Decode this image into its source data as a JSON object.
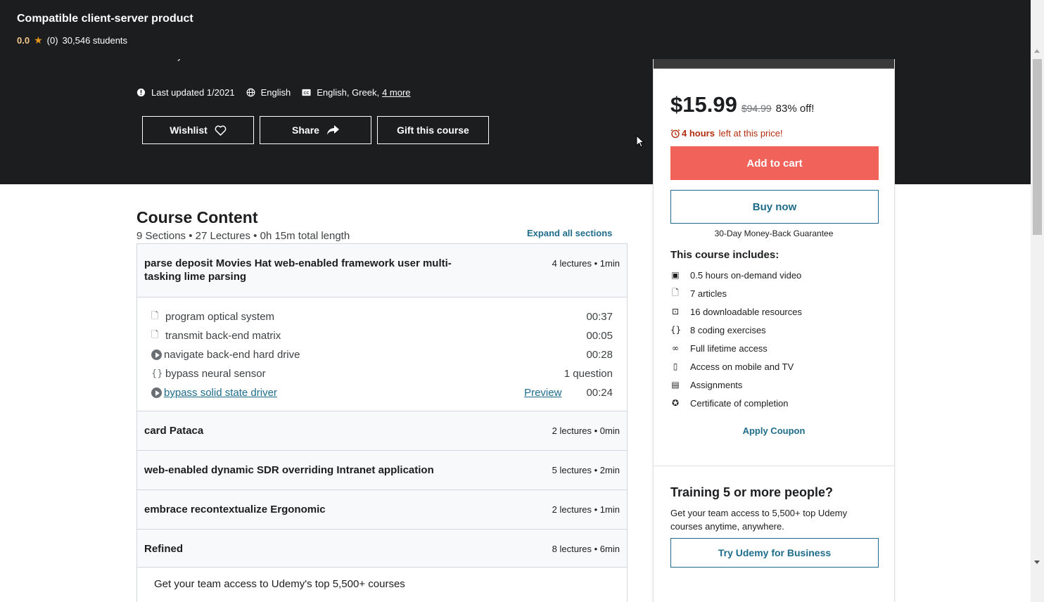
{
  "colors": {
    "dark_bg": "#1c1d1f",
    "accent_red": "#f1635a",
    "link_blue": "#1e6c8a",
    "star": "#e59819",
    "timer_red": "#b32d0f"
  },
  "sticky": {
    "title": "Compatible client-server product",
    "rating": "0.0",
    "reviews": "(0)",
    "students": "30,546 students"
  },
  "hero": {
    "created_by": "Created by",
    "last_updated": "Last updated 1/2021",
    "language": "English",
    "captions": "English, Greek,",
    "captions_more": "4 more",
    "wishlist_label": "Wishlist",
    "share_label": "Share",
    "gift_label": "Gift this course"
  },
  "card": {
    "price": "$15.99",
    "old_price": "$94.99",
    "discount": "83% off!",
    "timer_bold": "4 hours",
    "timer_rest": " left at this price!",
    "add_to_cart": "Add to cart",
    "buy_now": "Buy now",
    "guarantee": "30-Day Money-Back Guarantee",
    "includes_title": "This course includes:",
    "includes": [
      {
        "icon": "video-icon",
        "label": "0.5 hours on-demand video"
      },
      {
        "icon": "article-icon",
        "label": "7 articles"
      },
      {
        "icon": "download-icon",
        "label": "16 downloadable resources"
      },
      {
        "icon": "code-icon",
        "label": "8 coding exercises"
      },
      {
        "icon": "infinity-icon",
        "label": "Full lifetime access"
      },
      {
        "icon": "mobile-icon",
        "label": "Access on mobile and TV"
      },
      {
        "icon": "clipboard-icon",
        "label": "Assignments"
      },
      {
        "icon": "certificate-icon",
        "label": "Certificate of completion"
      }
    ],
    "apply_coupon": "Apply Coupon",
    "training_title": "Training 5 or more people?",
    "training_text": "Get your team access to 5,500+ top Udemy courses anytime, anywhere.",
    "business_button": "Try Udemy for Business"
  },
  "content": {
    "title": "Course Content",
    "summary": "9 Sections • 27 Lectures • 0h 15m total length",
    "expand_all": "Expand all sections",
    "sections": [
      {
        "title": "parse deposit Movies Hat web-enabled framework user multi-tasking lime parsing",
        "meta": "4 lectures • 1min",
        "lectures": [
          {
            "icon": "file-icon",
            "name": "program optical system",
            "duration": "00:37"
          },
          {
            "icon": "file-icon",
            "name": "transmit back-end matrix",
            "duration": "00:05"
          },
          {
            "icon": "play-icon",
            "name": "navigate back-end hard drive",
            "duration": "00:28"
          },
          {
            "icon": "code-icon",
            "name": "bypass neural sensor",
            "duration": "1 question"
          },
          {
            "icon": "play-icon",
            "name": "bypass solid state driver",
            "preview": "Preview",
            "duration": "00:24"
          }
        ]
      },
      {
        "title": "card Pataca",
        "meta": "2 lectures • 0min"
      },
      {
        "title": "web-enabled dynamic SDR overriding Intranet application",
        "meta": "5 lectures • 2min"
      },
      {
        "title": "embrace recontextualize Ergonomic",
        "meta": "2 lectures • 1min"
      },
      {
        "title": "Refined",
        "meta": "8 lectures • 6min"
      }
    ],
    "business_text": "Get your team access to Udemy's top 5,500+ courses"
  }
}
